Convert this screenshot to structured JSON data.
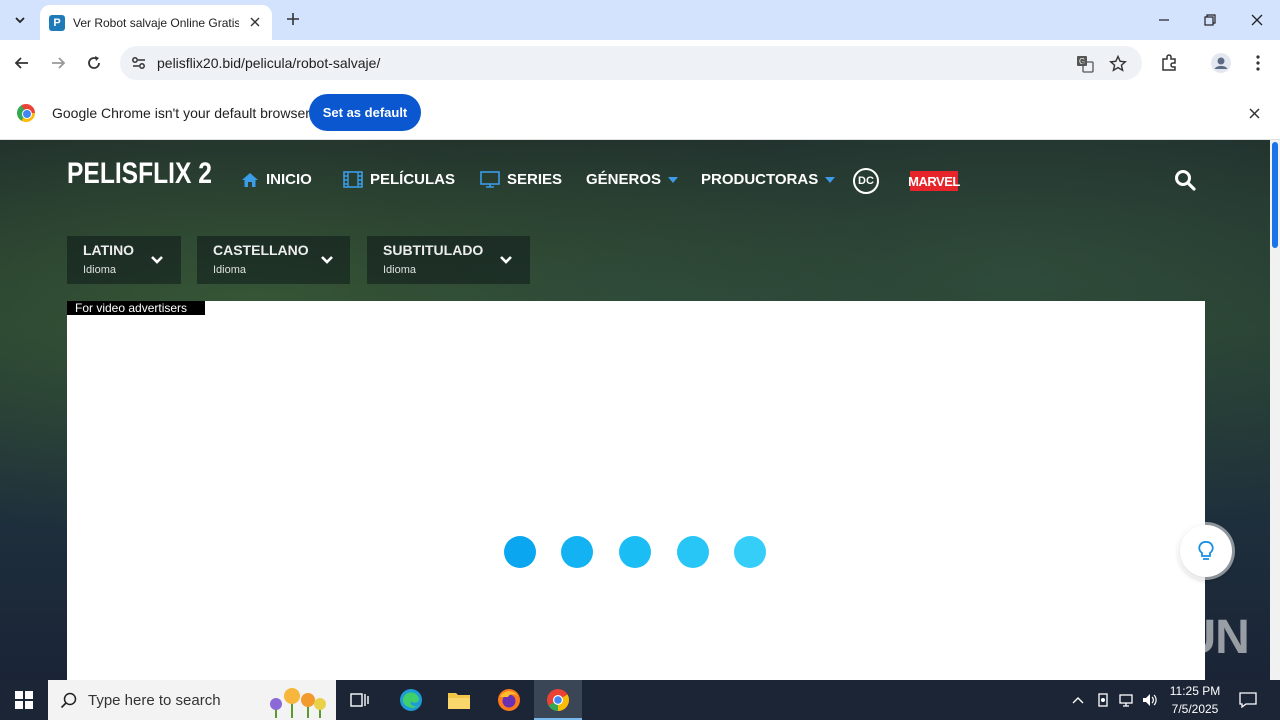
{
  "browser": {
    "tab": {
      "favicon_letter": "P",
      "title": "Ver Robot salvaje Online Gratis"
    },
    "url": "pelisflix20.bid/pelicula/robot-salvaje/",
    "infobar": {
      "message": "Google Chrome isn't your default browser",
      "button": "Set as default"
    }
  },
  "site": {
    "logo": "PELISFLIX 2",
    "nav": [
      {
        "label": "INICIO",
        "icon": "home-icon"
      },
      {
        "label": "PELÍCULAS",
        "icon": "film-icon"
      },
      {
        "label": "SERIES",
        "icon": "monitor-icon"
      },
      {
        "label": "GÉNEROS",
        "icon": "caret-down-icon"
      },
      {
        "label": "PRODUCTORAS",
        "icon": "caret-down-icon"
      }
    ],
    "dc_logo": "DC",
    "marvel_logo": "MARVEL",
    "languages": [
      {
        "title": "LATINO",
        "sub": "Idioma"
      },
      {
        "title": "CASTELLANO",
        "sub": "Idioma"
      },
      {
        "title": "SUBTITULADO",
        "sub": "Idioma"
      }
    ]
  },
  "ad": {
    "label": "For video advertisers",
    "dot_colors": [
      "#0aa6f0",
      "#12b2f3",
      "#1bbdf5",
      "#27c6f7",
      "#34cef9"
    ]
  },
  "watermark": "ANY RUN",
  "taskbar": {
    "search_placeholder": "Type here to search",
    "time": "11:25 PM",
    "date": "7/5/2025"
  },
  "colors": {
    "accent": "#3b9ce8",
    "chrome_blue": "#0b57d0",
    "taskbar": "#1c2535"
  }
}
